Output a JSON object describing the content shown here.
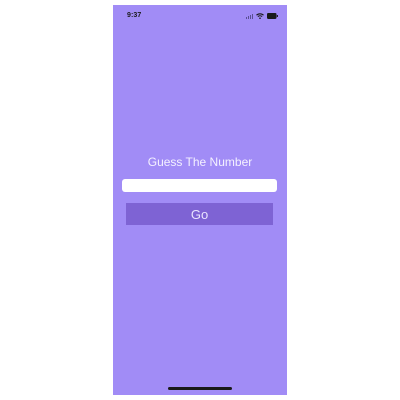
{
  "status_bar": {
    "time": "9:37",
    "icons": [
      "signal-icon",
      "wifi-icon",
      "battery-icon"
    ]
  },
  "main": {
    "title": "Guess The Number",
    "input": {
      "value": "",
      "placeholder": ""
    },
    "go_button_label": "Go"
  },
  "colors": {
    "background": "#a18cf6",
    "button": "#7e63d4",
    "input": "#ffffff"
  }
}
